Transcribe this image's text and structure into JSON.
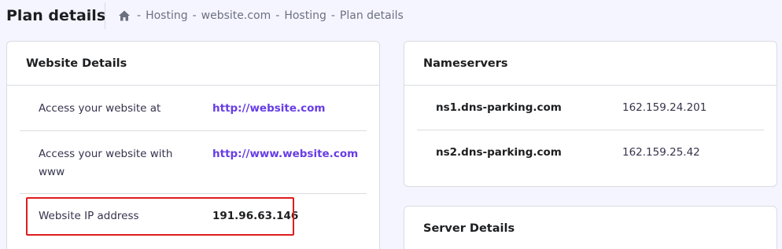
{
  "header": {
    "title": "Plan details",
    "breadcrumb": [
      "Hosting",
      "website.com",
      "Hosting",
      "Plan details"
    ]
  },
  "website_details": {
    "title": "Website Details",
    "rows": [
      {
        "label": "Access your website at",
        "value": "http://website.com"
      },
      {
        "label": "Access your website with www",
        "value": "http://www.website.com"
      },
      {
        "label": "Website IP address",
        "value": "191.96.63.146"
      }
    ]
  },
  "nameservers": {
    "title": "Nameservers",
    "rows": [
      {
        "name": "ns1.dns-parking.com",
        "ip": "162.159.24.201"
      },
      {
        "name": "ns2.dns-parking.com",
        "ip": "162.159.25.42"
      }
    ]
  },
  "server_details": {
    "title": "Server Details"
  },
  "colors": {
    "background": "#f4f5ff",
    "link": "#673de6",
    "highlight": "#e01c1c"
  },
  "icons": {
    "home": "home-icon"
  }
}
